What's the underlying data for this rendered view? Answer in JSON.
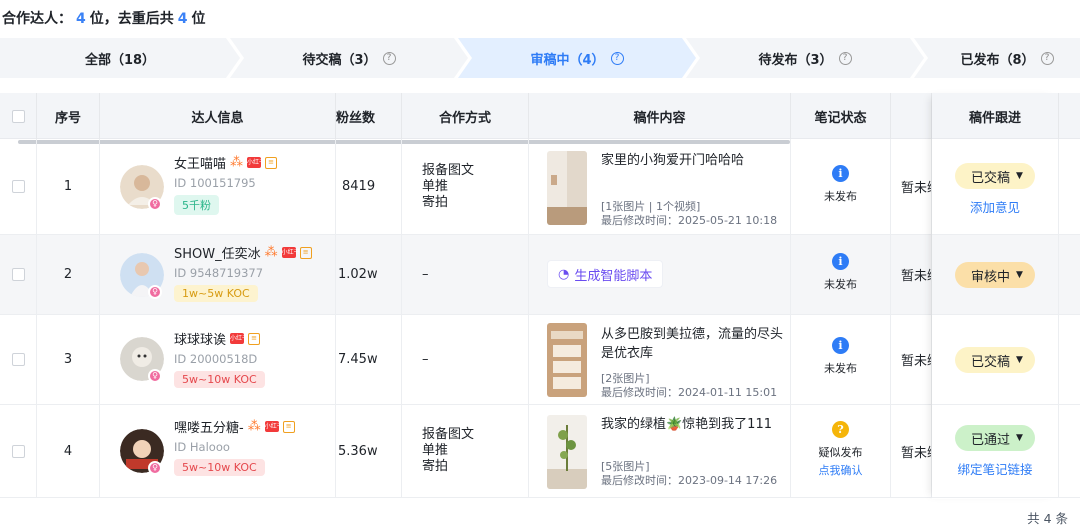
{
  "summary": {
    "prefix": "合作达人：",
    "count": "4",
    "mid": "位，去重后共",
    "dedup_count": "4",
    "suffix": "位"
  },
  "tabs": [
    {
      "label": "全部（18）",
      "help": false,
      "active": false
    },
    {
      "label": "待交稿（3）",
      "help": true,
      "active": false
    },
    {
      "label": "审稿中（4）",
      "help": true,
      "active": true
    },
    {
      "label": "待发布（3）",
      "help": true,
      "active": false
    },
    {
      "label": "已发布（8）",
      "help": true,
      "active": false
    }
  ],
  "columns": {
    "seq": "序号",
    "kol": "达人信息",
    "fans": "粉丝数",
    "coop": "合作方式",
    "content": "稿件内容",
    "note_status": "笔记状态",
    "follow": "稿件跟进"
  },
  "rows": [
    {
      "seq": "1",
      "name": "女王喵喵",
      "id": "ID 100151795",
      "fan_tag": "5千粉",
      "fan_tag_color": "green",
      "fans": "8419",
      "coop": [
        "报备图文",
        "单推",
        "寄拍"
      ],
      "content_title": "家里的小狗爱开门哈哈哈",
      "content_count": "[1张图片 | 1个视频]",
      "content_time": "最后修改时间：2025-05-21 10:18",
      "note_status": "未发布",
      "note_link": "",
      "extra": "暂未绑",
      "follow_status": "已交稿",
      "follow_link": "添加意见"
    },
    {
      "seq": "2",
      "name": "SHOW_任奕冰",
      "id": "ID 9548719377",
      "fan_tag": "1w~5w KOC",
      "fan_tag_color": "yellow",
      "fans": "1.02w",
      "coop_dash": "–",
      "ai_button": "生成智能脚本",
      "note_status": "未发布",
      "note_link": "",
      "extra": "暂未绑",
      "follow_status": "审核中",
      "follow_link": ""
    },
    {
      "seq": "3",
      "name": "球球球诶",
      "id": "ID 20000518D",
      "fan_tag": "5w~10w KOC",
      "fan_tag_color": "red",
      "fans": "7.45w",
      "coop_dash": "–",
      "content_title": "从多巴胺到美拉德，流量的尽头是优衣库",
      "content_count": "[2张图片]",
      "content_time": "最后修改时间：2024-01-11 15:01",
      "note_status": "未发布",
      "note_link": "",
      "extra": "暂未绑",
      "follow_status": "已交稿",
      "follow_link": ""
    },
    {
      "seq": "4",
      "name": "嘿喽五分糖-",
      "id": "ID Halooo",
      "fan_tag": "5w~10w KOC",
      "fan_tag_color": "red",
      "fans": "5.36w",
      "coop": [
        "报备图文",
        "单推",
        "寄拍"
      ],
      "content_title": "我家的绿植🪴惊艳到我了111",
      "content_count": "[5张图片]",
      "content_time": "最后修改时间：2023-09-14 17:26",
      "note_status": "疑似发布",
      "note_link": "点我确认",
      "extra": "暂未绑",
      "follow_status": "已通过",
      "follow_link": "绑定笔记链接"
    }
  ],
  "footer": "共 4 条",
  "colors": {
    "accent": "#2e7cf6",
    "active_tab_bg": "#e3efff",
    "tab_bg": "#f3f5f8",
    "ai_purple": "#6a4cf0"
  }
}
